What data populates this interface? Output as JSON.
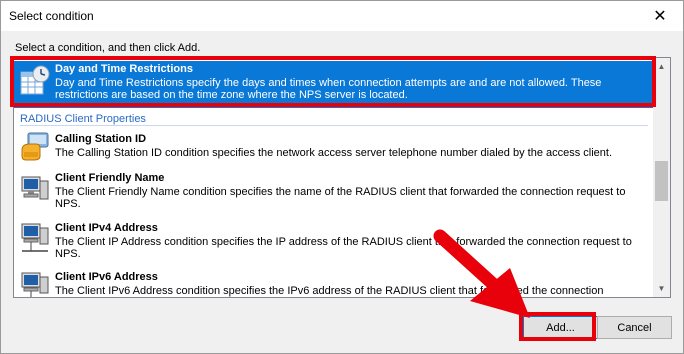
{
  "window": {
    "title": "Select condition",
    "close_glyph": "✕"
  },
  "prompt": "Select a condition, and then click Add.",
  "conditions": [
    {
      "name": "Day and Time Restrictions",
      "desc": "Day and Time Restrictions specify the days and times when connection attempts are and are not allowed. These restrictions are based on the time zone where the NPS server is located.",
      "icon": "calendar-clock-icon",
      "selected": true
    },
    {
      "name": "Calling Station ID",
      "desc": "The Calling Station ID condition specifies the network access server telephone number dialed by the access client.",
      "icon": "phone-icon"
    },
    {
      "name": "Client Friendly Name",
      "desc": "The Client Friendly Name condition specifies the name of the RADIUS client that forwarded the connection request to NPS.",
      "icon": "computer-icon"
    },
    {
      "name": "Client IPv4 Address",
      "desc": "The Client IP Address condition specifies the IP address of the RADIUS client that forwarded the connection request to NPS.",
      "icon": "network-computer-icon"
    },
    {
      "name": "Client IPv6 Address",
      "desc": "The Client IPv6 Address condition specifies the IPv6 address of the RADIUS client that forwarded the connection",
      "icon": "network-computer-icon"
    }
  ],
  "group_header": "RADIUS Client Properties",
  "buttons": {
    "add": "Add...",
    "cancel": "Cancel"
  },
  "colors": {
    "selection": "#0a78d7",
    "highlight": "#e8000b",
    "group_header": "#2a6bc4"
  }
}
